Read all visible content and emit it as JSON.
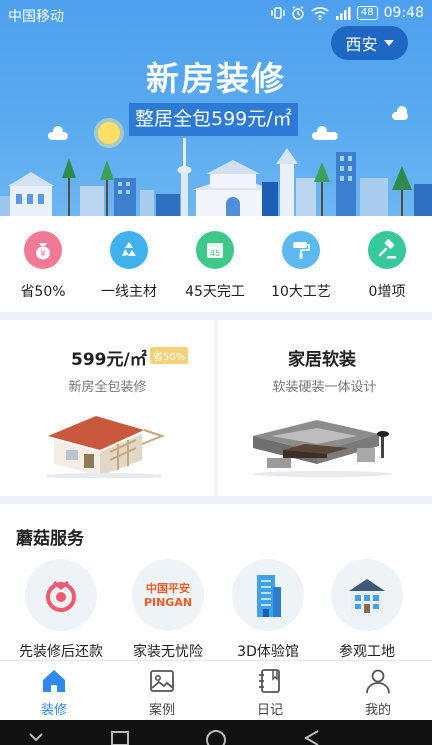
{
  "status": {
    "carrier": "中国移动",
    "battery": "48",
    "time": "09:48"
  },
  "city": {
    "label": "西安"
  },
  "hero": {
    "title": "新房装修",
    "subtitle": "整居全包599元/㎡"
  },
  "features": [
    {
      "label": "省50%",
      "icon": "money-bag-icon",
      "color": "#f07a95"
    },
    {
      "label": "一线主材",
      "icon": "recycle-icon",
      "color": "#3fb2ee"
    },
    {
      "label": "45天完工",
      "icon": "calendar-icon",
      "color": "#3cc98a",
      "icon_text": "45"
    },
    {
      "label": "10大工艺",
      "icon": "paint-roller-icon",
      "color": "#5bb9f0"
    },
    {
      "label": "0增项",
      "icon": "gavel-icon",
      "color": "#36c99b"
    }
  ],
  "cards": {
    "left": {
      "title": "599元/㎡",
      "badge": "省50%",
      "desc": "新房全包装修",
      "image": "house-construction-image"
    },
    "right": {
      "title": "家居软装",
      "desc": "软装硬装一体设计",
      "image": "sofa-set-image"
    }
  },
  "services": {
    "title": "蘑菇服务",
    "items": [
      {
        "label": "先装修后还款",
        "icon": "installment-logo-icon"
      },
      {
        "label": "家装无忧险",
        "icon": "pingan-logo-icon",
        "logo_cn": "中国平安",
        "logo_en": "PINGAN"
      },
      {
        "label": "3D体验馆",
        "icon": "building-icon"
      },
      {
        "label": "参观工地",
        "icon": "house-icon"
      }
    ]
  },
  "tabs": [
    {
      "label": "装修",
      "icon": "home-icon",
      "active": true
    },
    {
      "label": "案例",
      "icon": "image-icon",
      "active": false
    },
    {
      "label": "日记",
      "icon": "notebook-icon",
      "active": false
    },
    {
      "label": "我的",
      "icon": "user-icon",
      "active": false
    }
  ],
  "colors": {
    "accent": "#2f8af0",
    "hero_bg": "#55a7f0",
    "badge": "#f4d27a"
  }
}
